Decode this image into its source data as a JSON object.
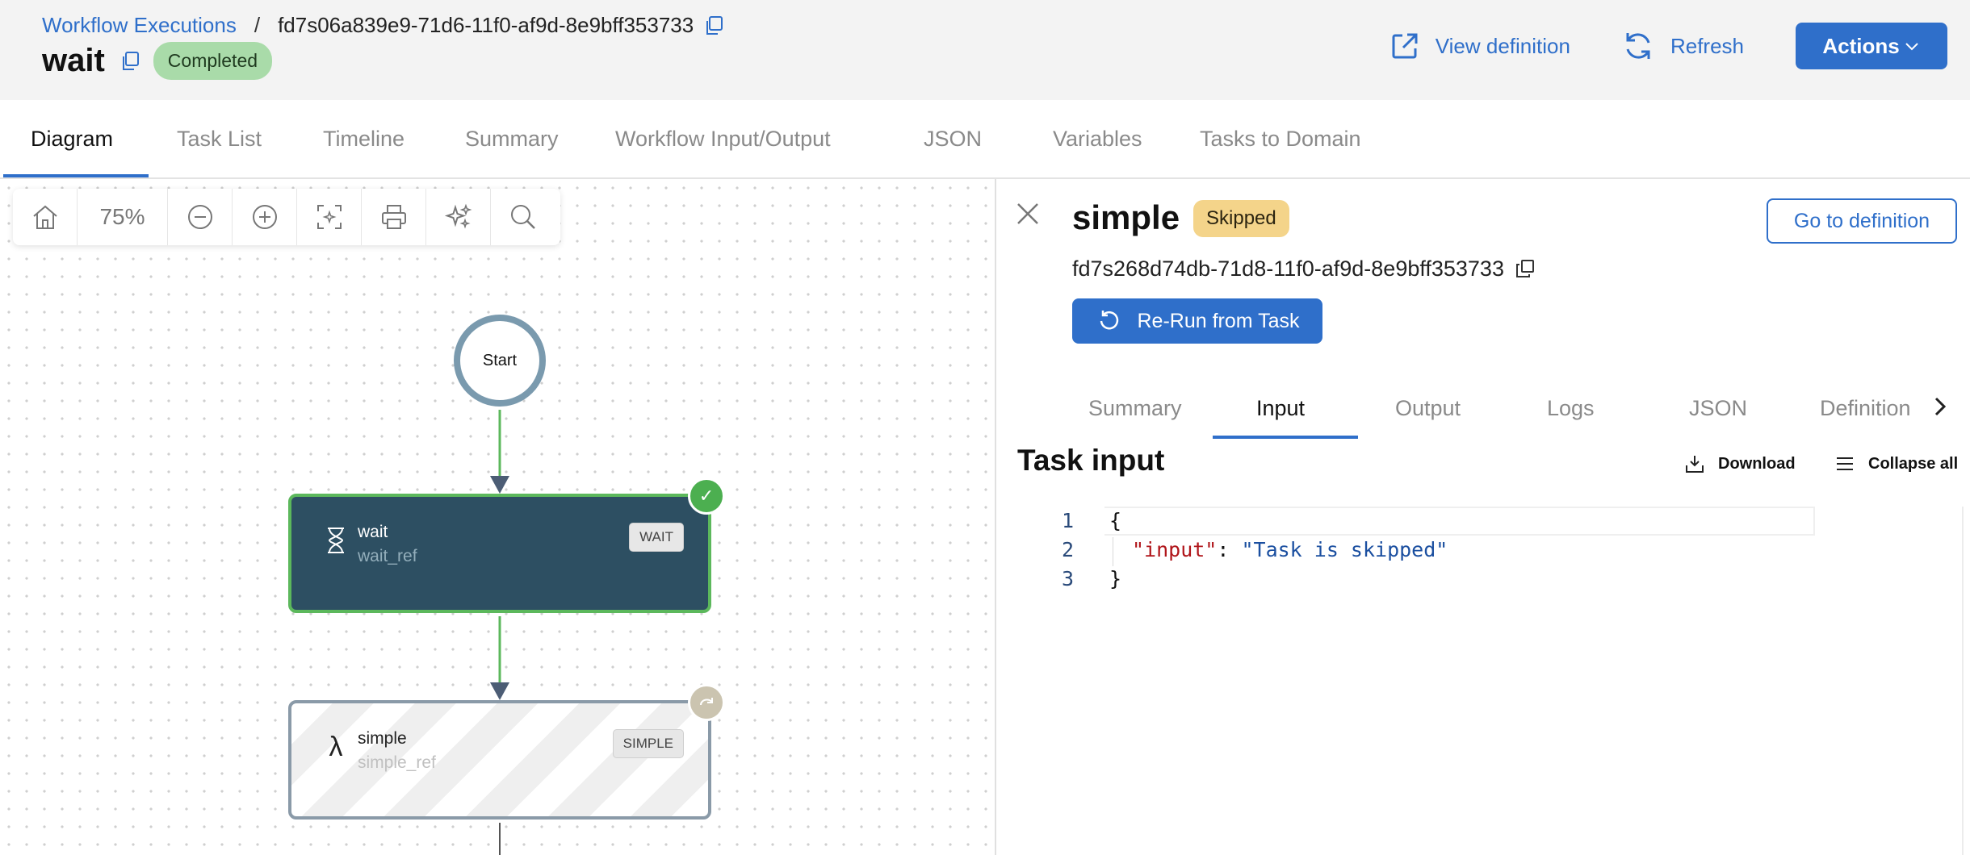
{
  "header": {
    "breadcrumb_link": "Workflow Executions",
    "breadcrumb_separator": "/",
    "execution_id": "fd7s06a839e9-71d6-11f0-af9d-8e9bff353733",
    "workflow_name": "wait",
    "status": "Completed",
    "view_definition_label": "View definition",
    "refresh_label": "Refresh",
    "actions_label": "Actions"
  },
  "tabs": [
    {
      "label": "Diagram",
      "active": true
    },
    {
      "label": "Task List"
    },
    {
      "label": "Timeline"
    },
    {
      "label": "Summary"
    },
    {
      "label": "Workflow Input/Output"
    },
    {
      "label": "JSON"
    },
    {
      "label": "Variables"
    },
    {
      "label": "Tasks to Domain"
    }
  ],
  "toolbar": {
    "zoom_level": "75%",
    "icons": [
      "home-icon",
      "zoom-out-icon",
      "zoom-in-icon",
      "fit-screen-icon",
      "print-icon",
      "sparkle-icon",
      "search-icon"
    ]
  },
  "diagram": {
    "start_label": "Start",
    "nodes": [
      {
        "name": "wait",
        "ref": "wait_ref",
        "type": "WAIT",
        "icon": "hourglass-icon",
        "status": "completed"
      },
      {
        "name": "simple",
        "ref": "simple_ref",
        "type": "SIMPLE",
        "icon": "lambda-icon",
        "status": "skipped"
      }
    ]
  },
  "panel": {
    "task_name": "simple",
    "status": "Skipped",
    "goto_definition_label": "Go to definition",
    "task_id": "fd7s268d74db-71d8-11f0-af9d-8e9bff353733",
    "rerun_label": "Re-Run from Task",
    "tabs": [
      {
        "label": "Summary"
      },
      {
        "label": "Input",
        "active": true
      },
      {
        "label": "Output"
      },
      {
        "label": "Logs"
      },
      {
        "label": "JSON"
      },
      {
        "label": "Definition"
      }
    ],
    "section_title": "Task input",
    "download_label": "Download",
    "collapse_label": "Collapse all",
    "code": {
      "line_numbers": [
        "1",
        "2",
        "3"
      ],
      "open_brace": "{",
      "key": "\"input\"",
      "colon": ": ",
      "value": "\"Task is skipped\"",
      "close_brace": "}"
    }
  },
  "colors": {
    "accent": "#2f6fca",
    "completed_badge": "#a9dba9",
    "skipped_badge": "#f4d48a",
    "wait_node": "#2d4f62",
    "success_edge": "#5cb85c"
  }
}
